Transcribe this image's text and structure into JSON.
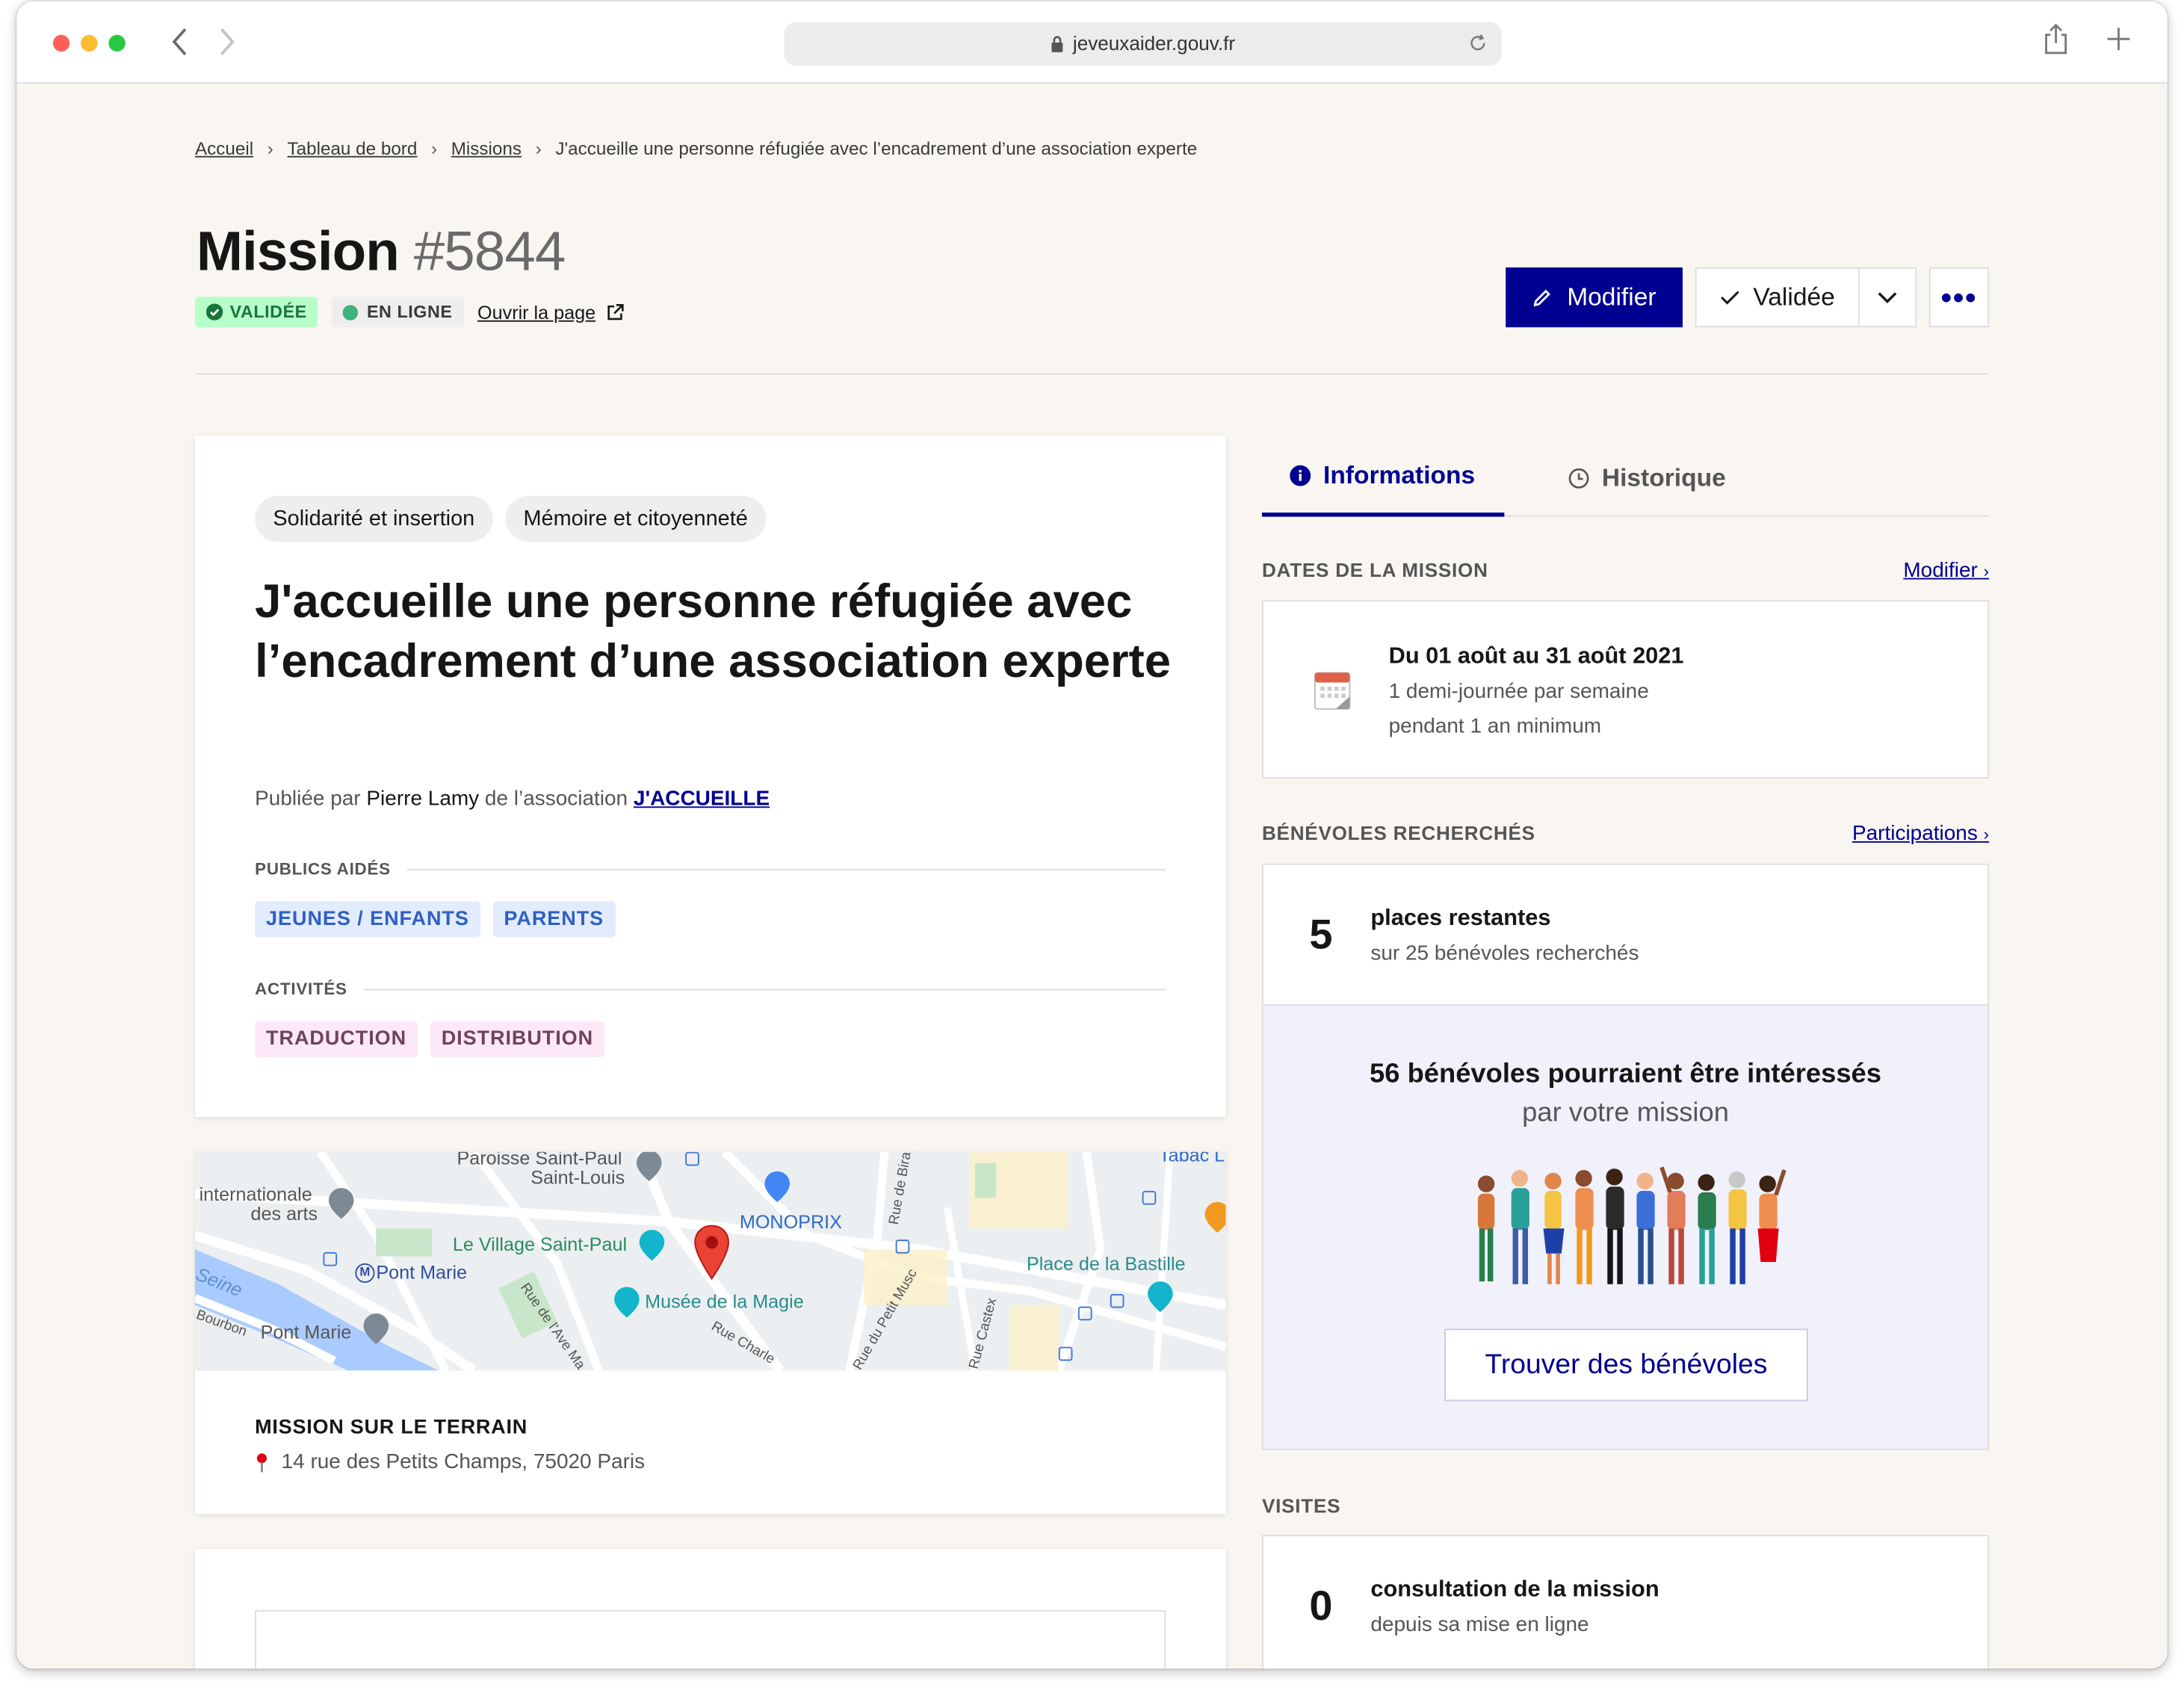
{
  "browser": {
    "url": "jeveuxaider.gouv.fr"
  },
  "breadcrumb": {
    "items": [
      "Accueil",
      "Tableau de bord",
      "Missions"
    ],
    "current": "J'accueille une personne réfugiée avec l’encadrement d’une association experte"
  },
  "header": {
    "title": "Mission",
    "number": "#5844",
    "badge_status": "VALIDÉE",
    "badge_online": "EN LIGNE",
    "open_page": "Ouvrir la page",
    "btn_edit": "Modifier",
    "btn_state": "Validée"
  },
  "mission": {
    "tags": [
      "Solidarité et insertion",
      "Mémoire et citoyenneté"
    ],
    "title": "J'accueille une personne réfugiée avec l’encadrement d’une association experte",
    "published_prefix": "Publiée par",
    "author": "Pierre Lamy",
    "assoc_prefix": "de l’association",
    "association": "J'ACCUEILLE",
    "publics_label": "PUBLICS AIDÉS",
    "publics": [
      "JEUNES / ENFANTS",
      "PARENTS"
    ],
    "activities_label": "ACTIVITÉS",
    "activities": [
      "TRADUCTION",
      "DISTRIBUTION"
    ]
  },
  "map": {
    "labels": [
      "Paroisse Saint-Paul",
      "Saint-Louis",
      "internationale",
      "des arts",
      "Le Village Saint-Paul",
      "MONOPRIX",
      "Pont Marie",
      "Seine",
      "Place de la Bastille",
      "Musée de la Magie",
      "Pont Marie",
      "Bourbon",
      "Rue de l'Ave Ma",
      "Rue Charle",
      "Rue du Petit Musc",
      "Rue de Birag",
      "Rue Castex",
      "Tabac L"
    ]
  },
  "location": {
    "label": "MISSION SUR LE TERRAIN",
    "address": "14 rue des Petits Champs, 75020 Paris"
  },
  "tabs": {
    "info": "Informations",
    "history": "Historique"
  },
  "dates": {
    "label": "DATES DE LA MISSION",
    "action": "Modifier",
    "range": "Du 01 août au 31 août 2021",
    "freq1": "1 demi-journée par semaine",
    "freq2": "pendant 1 an minimum"
  },
  "volunteers": {
    "label": "BÉNÉVOLES RECHERCHÉS",
    "action": "Participations",
    "count": "5",
    "title": "places restantes",
    "sub": "sur 25 bénévoles recherchés",
    "reco_title": "56 bénévoles pourraient être intéressés",
    "reco_sub": "par votre mission",
    "find_btn": "Trouver des bénévoles"
  },
  "visits": {
    "label": "VISITES",
    "count": "0",
    "title": "consultation de la mission",
    "sub": "depuis sa mise en ligne"
  },
  "colors": {
    "primary": "#000091",
    "success_bg": "#b8fec9",
    "success_fg": "#18753c",
    "page_bg": "#f9f6f2"
  }
}
